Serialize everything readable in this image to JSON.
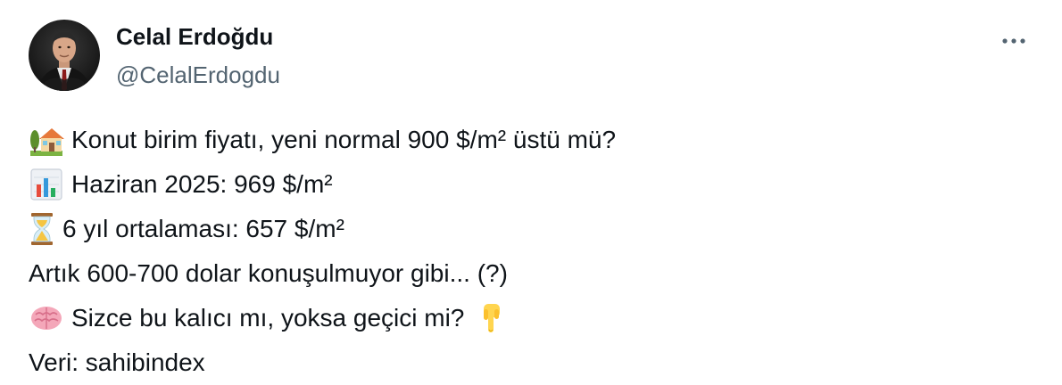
{
  "author": {
    "display_name": "Celal Erdoğdu",
    "handle": "@CelalErdogdu"
  },
  "tweet": {
    "lines": [
      {
        "emoji": "house-with-garden-icon",
        "text": "Konut birim fiyatı, yeni normal 900 $/m² üstü mü?"
      },
      {
        "emoji": "bar-chart-icon",
        "text": "Haziran 2025: 969 $/m²"
      },
      {
        "emoji": "hourglass-icon",
        "text": "6 yıl ortalaması: 657 $/m²"
      },
      {
        "emoji": "",
        "text": "Artık 600-700 dolar konuşulmuyor gibi... (?)"
      },
      {
        "emoji": "brain-icon",
        "text": "Sizce bu kalıcı mı, yoksa geçici mi?",
        "trailing_emoji": "backhand-index-pointing-down-icon"
      },
      {
        "emoji": "",
        "text": "Veri: sahibindex"
      }
    ]
  },
  "colors": {
    "text": "#0f1419",
    "secondary_text": "#536471",
    "background": "#ffffff"
  }
}
